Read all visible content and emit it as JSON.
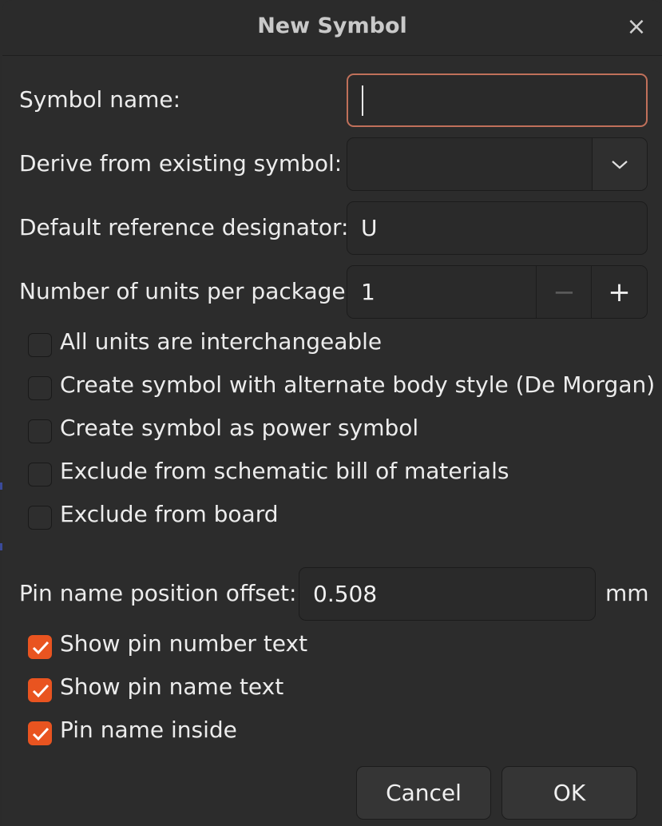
{
  "dialog": {
    "title": "New Symbol",
    "close_glyph": "×"
  },
  "fields": {
    "symbol_name": {
      "label": "Symbol name:",
      "value": ""
    },
    "derive_from": {
      "label": "Derive from existing symbol:",
      "value": ""
    },
    "reference_designator": {
      "label": "Default reference designator:",
      "value": "U"
    },
    "units_per_package": {
      "label": "Number of units per package:",
      "value": "1",
      "decrement_glyph": "−",
      "increment_glyph": "+"
    },
    "pin_name_offset": {
      "label": "Pin name position offset:",
      "value": "0.508",
      "unit": "mm"
    }
  },
  "options": [
    {
      "label": "All units are interchangeable",
      "checked": false
    },
    {
      "label": "Create symbol with alternate body style (De Morgan)",
      "checked": false
    },
    {
      "label": "Create symbol as power symbol",
      "checked": false
    },
    {
      "label": "Exclude from schematic bill of materials",
      "checked": false
    },
    {
      "label": "Exclude from board",
      "checked": false
    }
  ],
  "pin_options": [
    {
      "label": "Show pin number text",
      "checked": true
    },
    {
      "label": "Show pin name text",
      "checked": true
    },
    {
      "label": "Pin name inside",
      "checked": true
    }
  ],
  "buttons": {
    "cancel": "Cancel",
    "ok": "OK"
  },
  "colors": {
    "accent": "#e95420",
    "focus_border": "#c0705a",
    "background": "#2c2c2c",
    "field_background": "#2a2a2a"
  },
  "icons": {
    "close": "close-icon",
    "dropdown": "chevron-down-icon",
    "decrement": "minus-icon",
    "increment": "plus-icon",
    "check": "check-icon"
  }
}
